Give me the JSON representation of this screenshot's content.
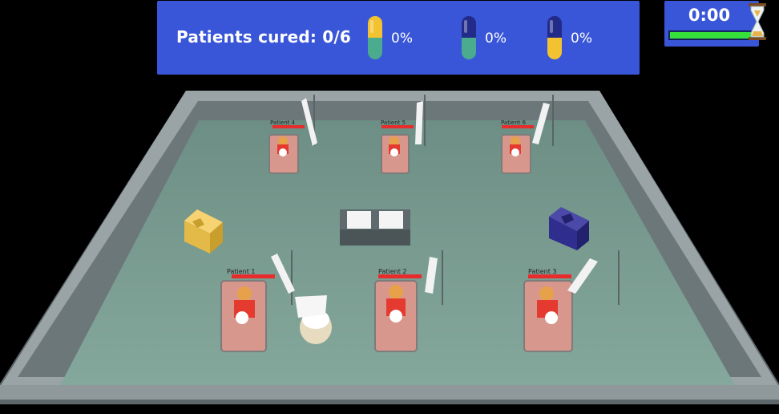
{
  "hud": {
    "cured_label": "Patients cured: 0/6",
    "medicines": [
      {
        "top_color": "#f2c230",
        "bottom_color": "#4aab8e",
        "percent": "0%"
      },
      {
        "top_color": "#232b8a",
        "bottom_color": "#4aab8e",
        "percent": "0%"
      },
      {
        "top_color": "#232b8a",
        "bottom_color": "#f2c230",
        "percent": "0%"
      }
    ]
  },
  "timer": {
    "time": "0:00",
    "progress": 0.98,
    "bar_color": "#35e03a"
  },
  "patients": [
    {
      "label": "Patient 4"
    },
    {
      "label": "Patient 5"
    },
    {
      "label": "Patient 6"
    },
    {
      "label": "Patient 1"
    },
    {
      "label": "Patient 2"
    },
    {
      "label": "Patient 3"
    }
  ],
  "colors": {
    "floor": "#74978c",
    "wall_top": "#8a9396",
    "hud": "#3a56d8"
  }
}
